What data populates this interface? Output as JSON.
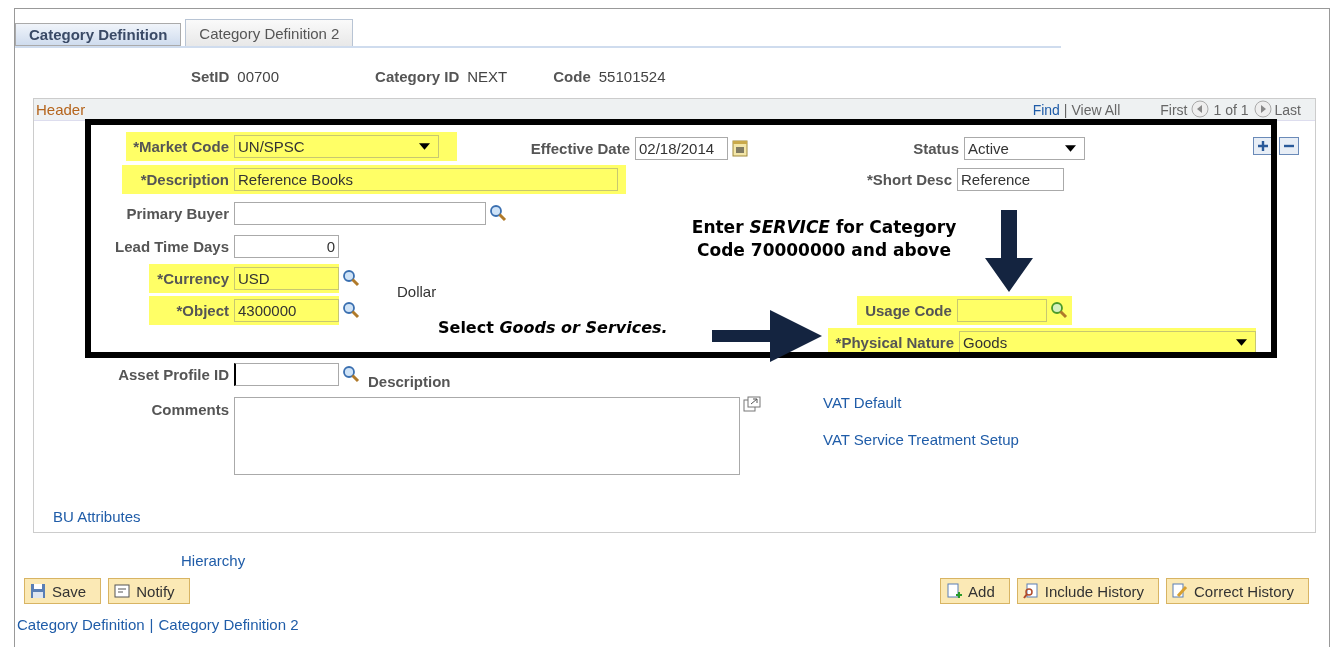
{
  "tabs": [
    {
      "label": "Category Definition",
      "selected": true
    },
    {
      "label": "Category Definition 2",
      "selected": false
    }
  ],
  "keys": [
    {
      "label": "SetID",
      "value": "00700"
    },
    {
      "label": "Category ID",
      "value": "NEXT"
    },
    {
      "label": "Code",
      "value": "55101524"
    }
  ],
  "panel": {
    "title": "Header",
    "find": "Find",
    "separator": "|",
    "view_all": "View All",
    "first": "First",
    "count": "1 of 1",
    "last": "Last"
  },
  "market_code": {
    "label": "*Market Code",
    "value": "UN/SPSC",
    "highlighted": true
  },
  "effective_date": {
    "label": "Effective Date",
    "value": "02/18/2014"
  },
  "status": {
    "label": "Status",
    "value": "Active"
  },
  "description": {
    "label": "*Description",
    "value": "Reference Books",
    "highlighted": true
  },
  "short_desc": {
    "label": "*Short Desc",
    "value": "Reference"
  },
  "primary_buyer": {
    "label": "Primary Buyer"
  },
  "lead_time_days": {
    "label": "Lead Time Days",
    "value": "0"
  },
  "currency": {
    "label": "*Currency",
    "value": "USD",
    "highlighted": true
  },
  "currency_description": "Dollar",
  "object": {
    "label": "*Object",
    "value": "4300000",
    "highlighted": true
  },
  "usage_code": {
    "label": "Usage Code",
    "highlighted": true
  },
  "physical_nature": {
    "label": "*Physical Nature",
    "value": "Goods",
    "highlighted": true
  },
  "asset_profile_id": {
    "label": "Asset Profile ID"
  },
  "asset_description_label": "Description",
  "comments": {
    "label": "Comments"
  },
  "links": [
    "VAT Default",
    "VAT Service Treatment Setup"
  ],
  "bu_attributes": "BU Attributes",
  "hierarchy": "Hierarchy",
  "buttons_left": [
    {
      "label": "Save",
      "kind": "save"
    },
    {
      "label": "Notify",
      "kind": "notify"
    }
  ],
  "buttons_right": [
    {
      "label": "Add",
      "kind": "add"
    },
    {
      "label": "Include History",
      "kind": "include"
    },
    {
      "label": "Correct History",
      "kind": "correct"
    }
  ],
  "footer": {
    "links": [
      "Category Definition",
      "Category Definition 2"
    ],
    "separator": "|"
  },
  "annotations": {
    "service_note": [
      "Enter *SERVICE* for Category",
      "Code 70000000 and above"
    ],
    "goods_note": "Select *Goods or Services.*"
  }
}
